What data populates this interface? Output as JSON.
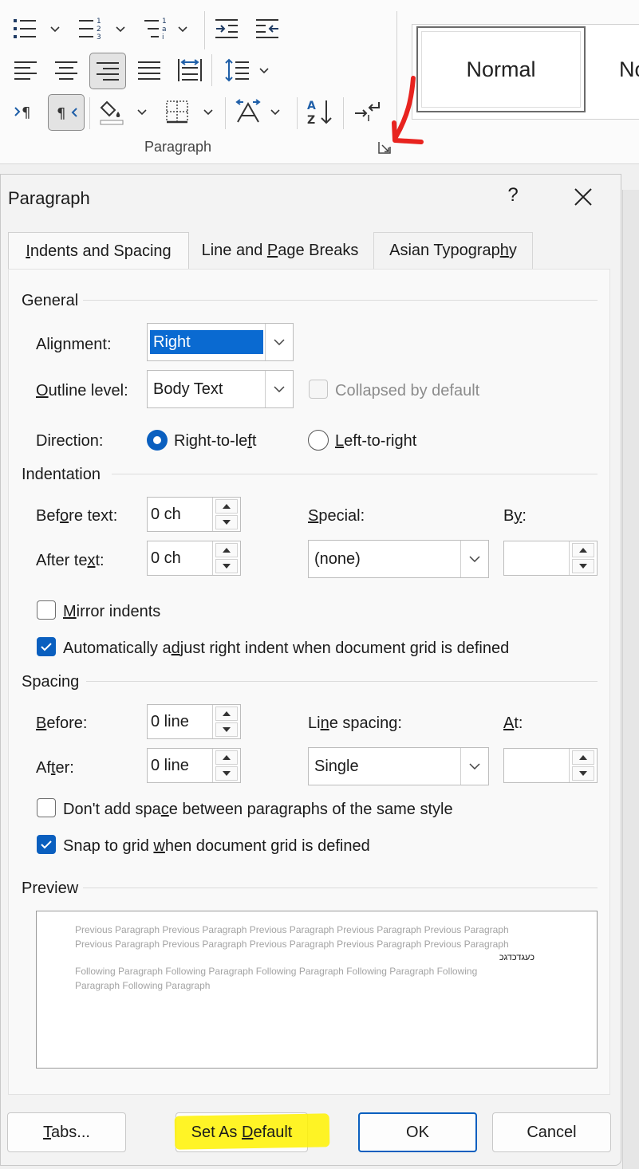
{
  "ribbon": {
    "group_label": "Paragraph",
    "styles": {
      "normal": "Normal",
      "next_partial": "No"
    },
    "buttons": [
      {
        "name": "bullets-icon"
      },
      {
        "name": "numbering-icon"
      },
      {
        "name": "multilevel-list-icon"
      },
      {
        "name": "decrease-indent-icon"
      },
      {
        "name": "increase-indent-icon"
      },
      {
        "name": "align-left-icon"
      },
      {
        "name": "align-center-icon"
      },
      {
        "name": "align-right-icon"
      },
      {
        "name": "justify-icon"
      },
      {
        "name": "distributed-icon"
      },
      {
        "name": "line-spacing-icon"
      },
      {
        "name": "ltr-icon"
      },
      {
        "name": "rtl-icon"
      },
      {
        "name": "shading-icon"
      },
      {
        "name": "borders-icon"
      },
      {
        "name": "asian-layout-icon"
      },
      {
        "name": "sort-icon"
      },
      {
        "name": "show-marks-icon"
      }
    ],
    "accent_selected": "#e3e3e3",
    "annotation_color": "#e8231f"
  },
  "dialog": {
    "title": "Paragraph",
    "help": "?",
    "tabs": [
      {
        "pre": "",
        "u": "I",
        "post": "ndents and Spacing",
        "active": true
      },
      {
        "pre": "Line and ",
        "u": "P",
        "post": "age Breaks",
        "active": false
      },
      {
        "pre": "Asian Typograp",
        "u": "h",
        "post": "y",
        "active": false
      }
    ],
    "general": {
      "heading": "General",
      "alignment_label": {
        "pre": "Ali",
        "u": "g",
        "post": "nment:"
      },
      "alignment_value": "Right",
      "outline_label": {
        "pre": "",
        "u": "O",
        "post": "utline level:"
      },
      "outline_value": "Body Text",
      "collapsed_label": "Collapsed by default",
      "direction_label": "Direction:",
      "rtl_label": {
        "pre": "Right-to-le",
        "u": "f",
        "post": "t"
      },
      "ltr_label": {
        "pre": "",
        "u": "L",
        "post": "eft-to-right"
      }
    },
    "indentation": {
      "heading": "Indentation",
      "before_label": {
        "pre": "Bef",
        "u": "o",
        "post": "re text:"
      },
      "before_value": "0 ch",
      "after_label": {
        "pre": "After te",
        "u": "x",
        "post": "t:"
      },
      "after_value": "0 ch",
      "special_label": {
        "pre": "",
        "u": "S",
        "post": "pecial:"
      },
      "special_value": "(none)",
      "by_label": {
        "pre": "B",
        "u": "y",
        "post": ":"
      },
      "by_value": "",
      "mirror_label": {
        "pre": "",
        "u": "M",
        "post": "irror indents"
      },
      "auto_adjust_label": {
        "pre": "Automatically a",
        "u": "d",
        "post": "just right indent when document grid is defined"
      }
    },
    "spacing": {
      "heading": "Spacing",
      "before_label": {
        "pre": "",
        "u": "B",
        "post": "efore:"
      },
      "before_value": "0 line",
      "after_label": {
        "pre": "Af",
        "u": "t",
        "post": "er:"
      },
      "after_value": "0 line",
      "line_spacing_label": {
        "pre": "Li",
        "u": "n",
        "post": "e spacing:"
      },
      "line_spacing_value": "Single",
      "at_label": {
        "pre": "",
        "u": "A",
        "post": "t:"
      },
      "at_value": "",
      "dont_add_label": {
        "pre": "Don't add spa",
        "u": "c",
        "post": "e between paragraphs of the same style"
      },
      "snap_label": {
        "pre": "Snap to grid ",
        "u": "w",
        "post": "hen document grid is defined"
      }
    },
    "preview": {
      "heading": "Preview",
      "prev_line1": "Previous Paragraph Previous Paragraph Previous Paragraph Previous Paragraph Previous Paragraph",
      "prev_line2": "Previous Paragraph Previous Paragraph Previous Paragraph Previous Paragraph Previous Paragraph",
      "current": "כעגדכדגכ",
      "next_line1": "Following Paragraph Following Paragraph Following Paragraph Following Paragraph Following",
      "next_line2": "Paragraph Following Paragraph"
    },
    "buttons": {
      "tabs": {
        "pre": "",
        "u": "T",
        "post": "abs..."
      },
      "set_default": {
        "pre": "Set As ",
        "u": "D",
        "post": "efault"
      },
      "ok": "OK",
      "cancel": "Cancel"
    },
    "colors": {
      "accent": "#0a5fbf",
      "highlight": "#fff200"
    }
  }
}
